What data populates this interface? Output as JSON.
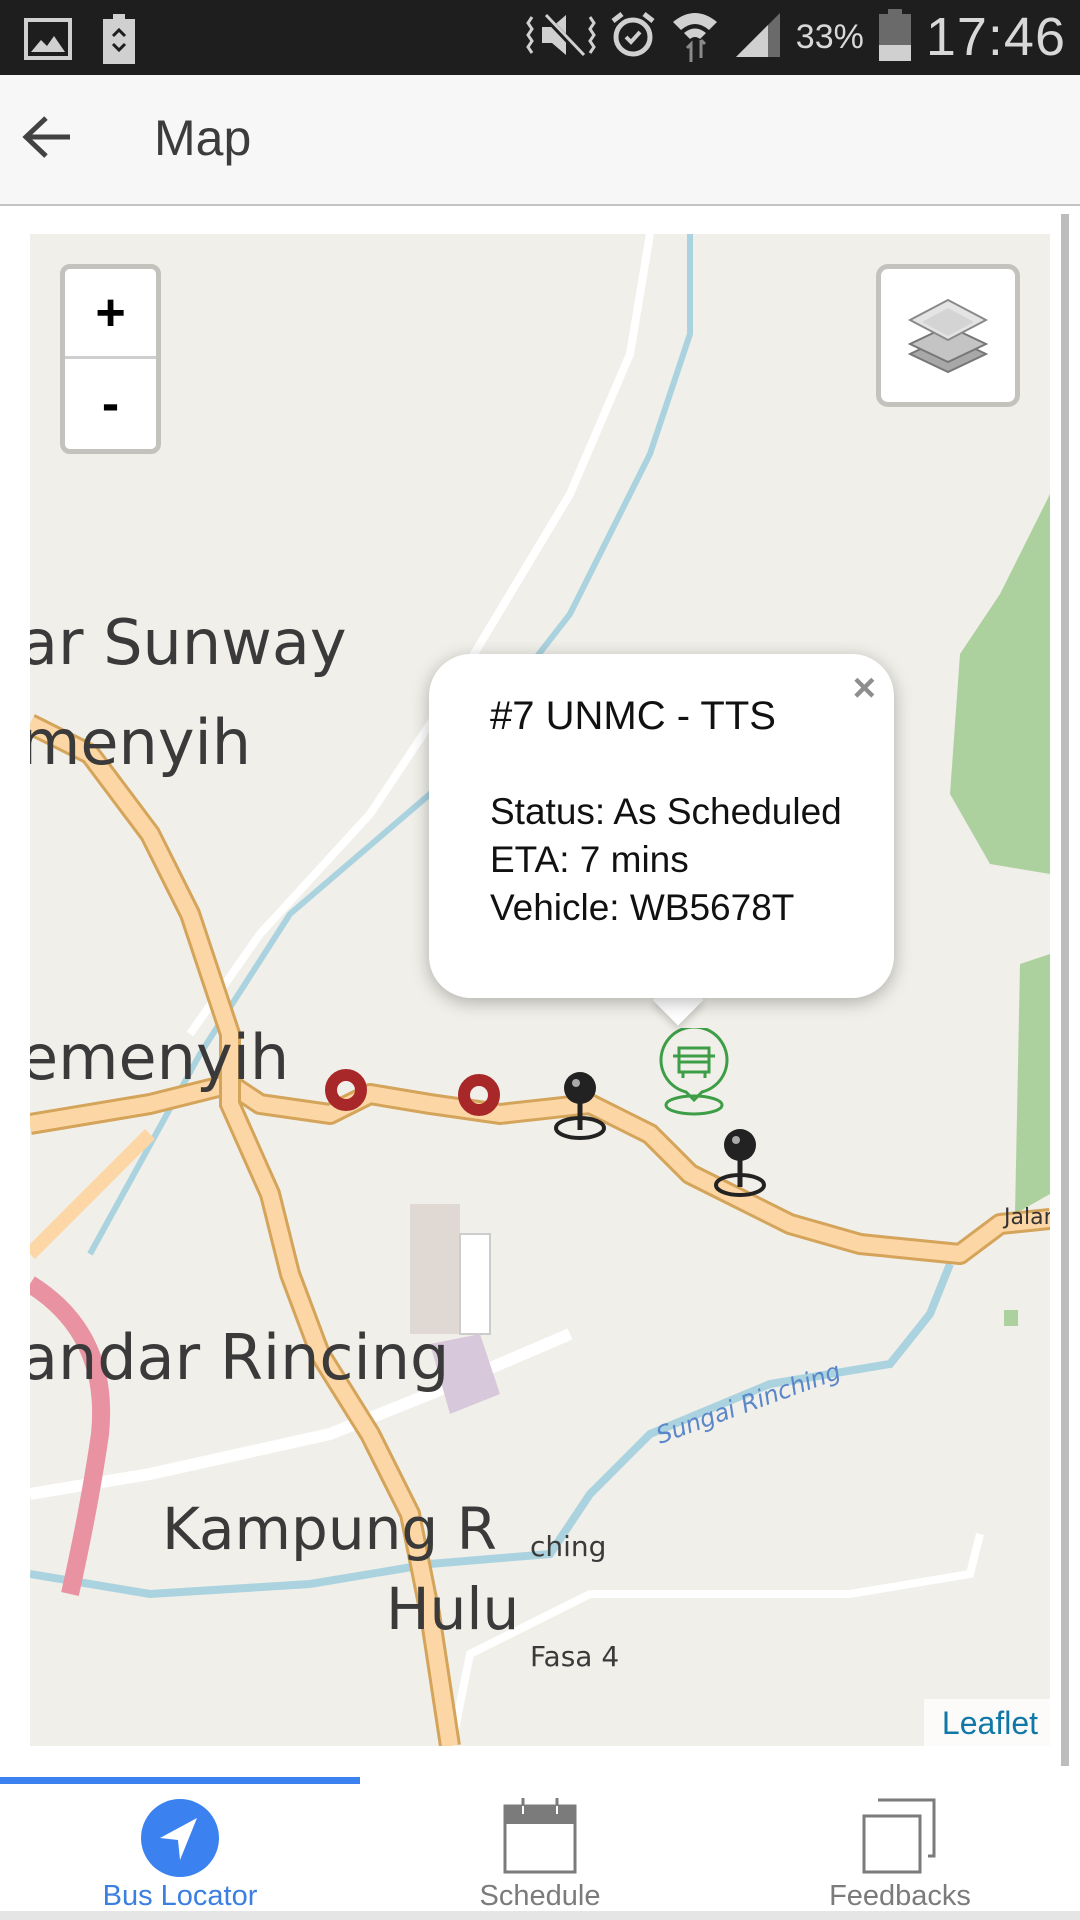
{
  "status_bar": {
    "left_icons": [
      "gallery-icon",
      "battery-saver-icon"
    ],
    "right_icons": [
      "mute-vibrate-icon",
      "alarm-icon",
      "wifi-icon",
      "signal-icon",
      "battery-icon"
    ],
    "battery_percent": "33%",
    "time": "17:46"
  },
  "app_bar": {
    "back_icon": "arrow-left-icon",
    "title": "Map"
  },
  "map": {
    "zoom_in_label": "+",
    "zoom_out_label": "-",
    "layers_icon": "layers-icon",
    "attribution": "Leaflet",
    "labels": {
      "place_1": "ar Sunway",
      "place_2": "menyih",
      "place_3": "emenyih",
      "place_4": "andar Rincing",
      "place_5": "Kampung R",
      "place_5b": "ching",
      "place_6": "Hulu",
      "place_7": "Fasa 4",
      "river": "Sungai Rinching",
      "road": "Jalan"
    },
    "markers": [
      {
        "type": "stop",
        "color": "#a8282a"
      },
      {
        "type": "stop",
        "color": "#a8282a"
      },
      {
        "type": "pin",
        "color": "#222222"
      },
      {
        "type": "bus",
        "color": "#3d9e47"
      },
      {
        "type": "pin",
        "color": "#222222"
      }
    ],
    "popup": {
      "title": "#7 UNMC - TTS",
      "status": "Status: As Scheduled",
      "eta": "ETA: 7 mins",
      "vehicle": "Vehicle: WB5678T",
      "close_label": "×"
    }
  },
  "bottom_nav": {
    "active_color": "#3b82f0",
    "items": [
      {
        "label": "Bus Locator",
        "icon": "navigation-arrow-icon",
        "active": true
      },
      {
        "label": "Schedule",
        "icon": "calendar-icon",
        "active": false
      },
      {
        "label": "Feedbacks",
        "icon": "copy-pages-icon",
        "active": false
      }
    ]
  }
}
